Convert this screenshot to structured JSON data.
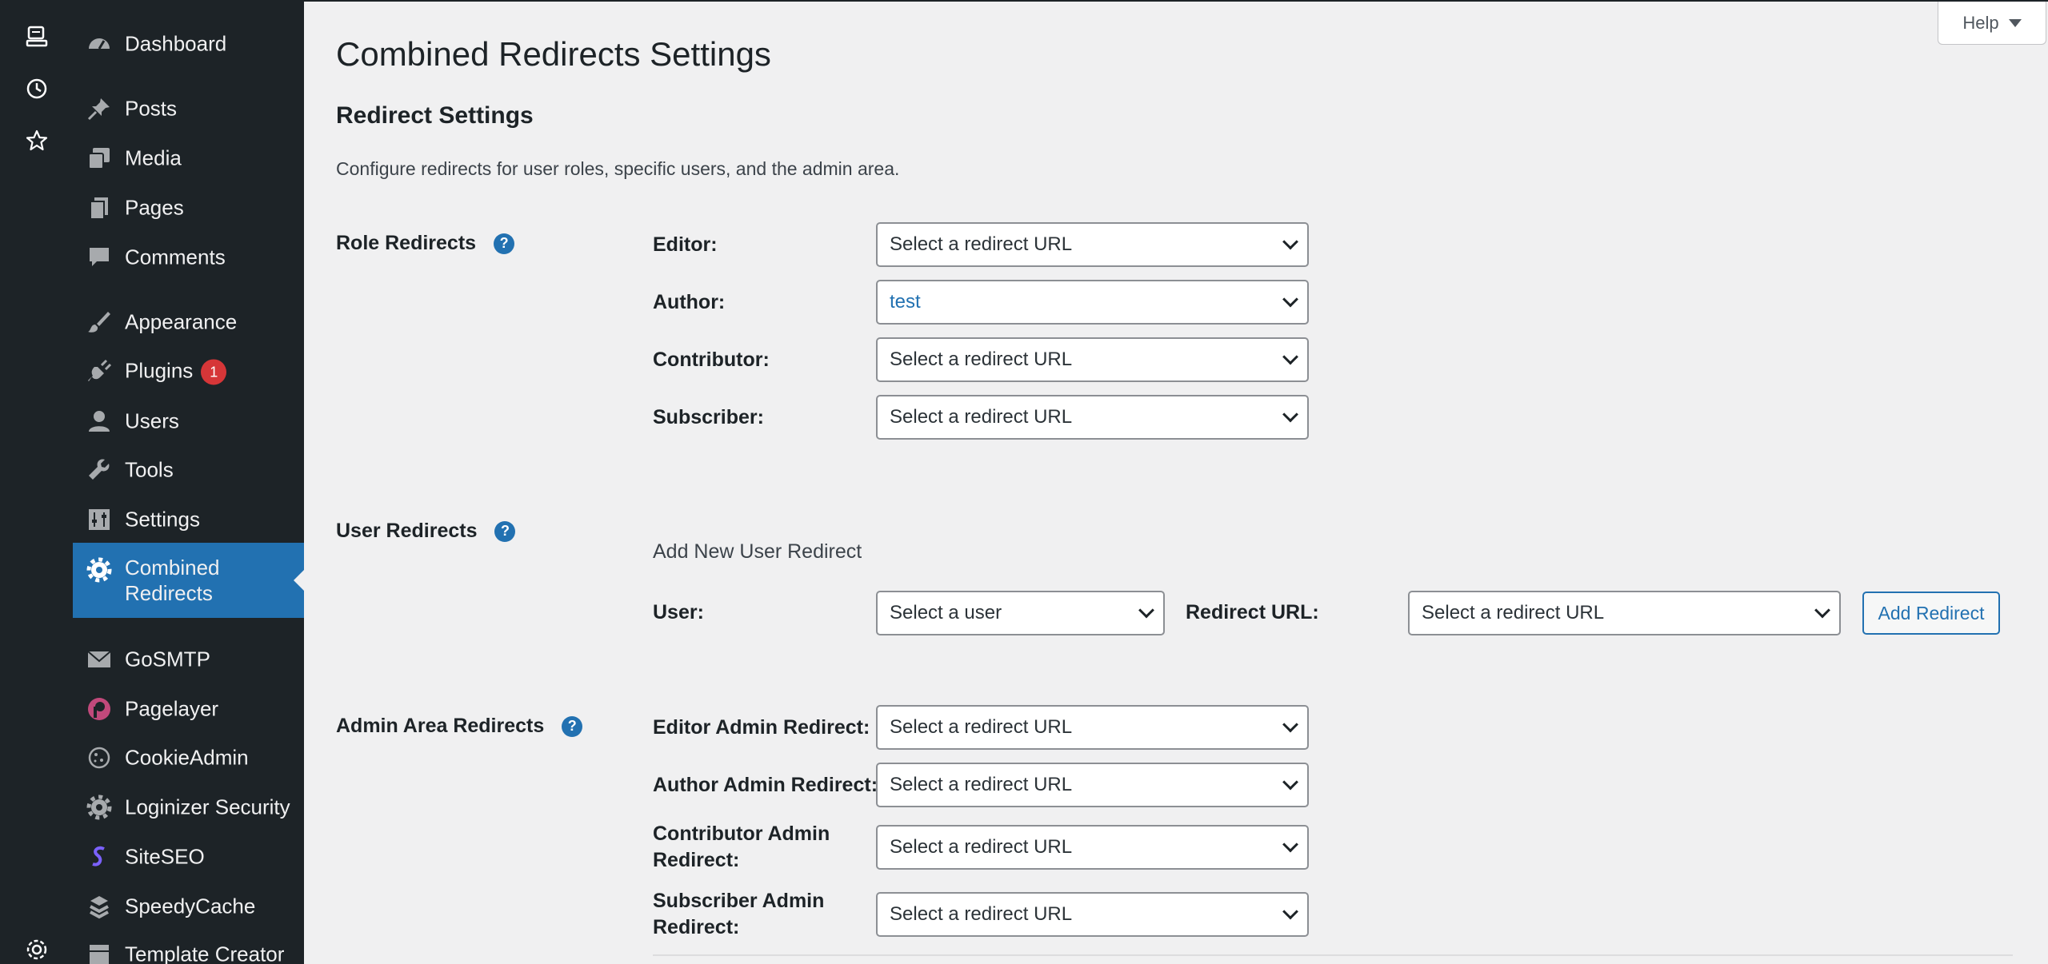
{
  "rail": {
    "icons": [
      "monitor-icon",
      "clock-icon",
      "star-icon",
      "gear-icon"
    ]
  },
  "menu": {
    "items": [
      {
        "label": "Dashboard",
        "icon": "dashboard-icon"
      },
      {
        "label": "Posts",
        "icon": "pin-icon"
      },
      {
        "label": "Media",
        "icon": "media-icon"
      },
      {
        "label": "Pages",
        "icon": "pages-icon"
      },
      {
        "label": "Comments",
        "icon": "comment-icon"
      },
      {
        "label": "Appearance",
        "icon": "brush-icon"
      },
      {
        "label": "Plugins",
        "icon": "plug-icon",
        "badge": "1"
      },
      {
        "label": "Users",
        "icon": "user-icon"
      },
      {
        "label": "Tools",
        "icon": "wrench-icon"
      },
      {
        "label": "Settings",
        "icon": "sliders-icon"
      },
      {
        "label": "Combined Redirects",
        "icon": "gear-icon"
      },
      {
        "label": "GoSMTP",
        "icon": "envelope-icon"
      },
      {
        "label": "Pagelayer",
        "icon": "pagelayer-icon"
      },
      {
        "label": "CookieAdmin",
        "icon": "cookie-icon"
      },
      {
        "label": "Loginizer Security",
        "icon": "gear-icon"
      },
      {
        "label": "SiteSEO",
        "icon": "siteseo-icon"
      },
      {
        "label": "SpeedyCache",
        "icon": "speedycache-icon"
      },
      {
        "label": "Template Creator",
        "icon": "template-icon"
      }
    ]
  },
  "help": {
    "label": "Help"
  },
  "page": {
    "title": "Combined Redirects Settings",
    "section_title": "Redirect Settings",
    "description": "Configure redirects for user roles, specific users, and the admin area."
  },
  "role_redirects": {
    "title": "Role Redirects",
    "rows": [
      {
        "label": "Editor:",
        "value": "Select a redirect URL"
      },
      {
        "label": "Author:",
        "value": "test"
      },
      {
        "label": "Contributor:",
        "value": "Select a redirect URL"
      },
      {
        "label": "Subscriber:",
        "value": "Select a redirect URL"
      }
    ]
  },
  "user_redirects": {
    "title": "User Redirects",
    "subheading": "Add New User Redirect",
    "user_label": "User:",
    "user_value": "Select a user",
    "url_label": "Redirect URL:",
    "url_value": "Select a redirect URL",
    "add_button": "Add Redirect"
  },
  "admin_redirects": {
    "title": "Admin Area Redirects",
    "rows": [
      {
        "label": "Editor Admin Redirect:",
        "value": "Select a redirect URL"
      },
      {
        "label": "Author Admin Redirect:",
        "value": "Select a redirect URL"
      },
      {
        "label": "Contributor Admin Redirect:",
        "value": "Select a redirect URL"
      },
      {
        "label": "Subscriber Admin Redirect:",
        "value": "Select a redirect URL"
      }
    ]
  },
  "colors": {
    "accent": "#2271b1",
    "menu_bg": "#1d2327",
    "badge": "#d63638"
  }
}
